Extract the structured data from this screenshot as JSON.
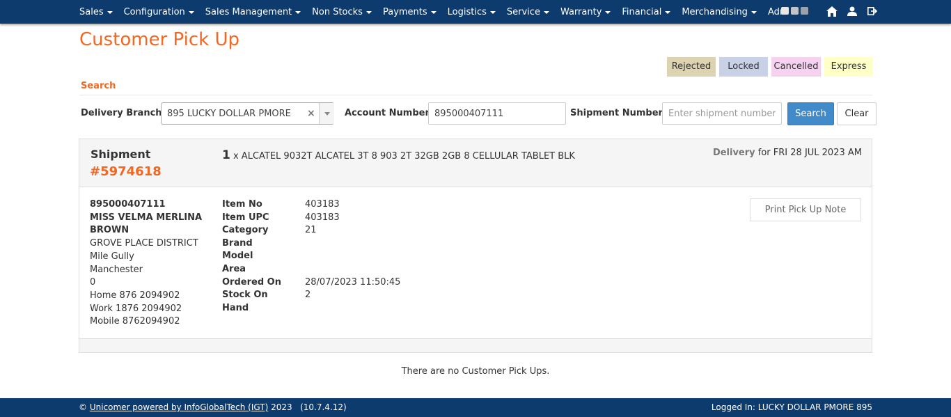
{
  "nav": {
    "items": [
      "Sales",
      "Configuration",
      "Sales Management",
      "Non Stocks",
      "Payments",
      "Logistics",
      "Service",
      "Warranty",
      "Financial",
      "Merchandising",
      "Administration"
    ],
    "icons": [
      "home-icon",
      "user-icon",
      "logout-icon"
    ]
  },
  "page": {
    "title": "Customer Pick Up"
  },
  "legend": [
    {
      "label": "Rejected",
      "color": "#ddd3b0"
    },
    {
      "label": "Locked",
      "color": "#c8d1e6"
    },
    {
      "label": "Cancelled",
      "color": "#f6d2f0"
    },
    {
      "label": "Express",
      "color": "#ffffc8"
    }
  ],
  "search": {
    "section_label": "Search",
    "branch_label": "Delivery Branch:",
    "branch_value": "895 LUCKY DOLLAR PMORE",
    "clear_glyph": "×",
    "account_label": "Account Number:",
    "account_value": "895000407111",
    "shipment_label": "Shipment Number:",
    "shipment_placeholder": "Enter shipment number",
    "search_button": "Search",
    "clear_button": "Clear"
  },
  "shipment": {
    "label": "Shipment",
    "number": "#5974618",
    "qty": "1",
    "item_text": "x ALCATEL 9032T ALCATEL 3T 8 903 2T 32GB 2GB 8 CELLULAR TABLET BLK",
    "delivery_label": "Delivery",
    "delivery_text": "for FRI 28 JUL 2023 AM",
    "customer": {
      "account": "895000407111",
      "name": "MISS VELMA MERLINA BROWN",
      "address": [
        "GROVE PLACE DISTRICT",
        "Mile Gully",
        "Manchester",
        "0"
      ],
      "phones": [
        "Home 876 2094902",
        "Work 1876 2094902",
        "Mobile 8762094902"
      ]
    },
    "details": [
      {
        "label": "Item No",
        "value": "403183"
      },
      {
        "label": "Item UPC",
        "value": "403183"
      },
      {
        "label": "Category",
        "value": "21"
      },
      {
        "label": "Brand",
        "value": ""
      },
      {
        "label": "Model",
        "value": ""
      },
      {
        "label": "Area",
        "value": ""
      },
      {
        "label": "Ordered On",
        "value": "28/07/2023 11:50:45"
      },
      {
        "label": "Stock On Hand",
        "value": "2"
      }
    ],
    "print_button": "Print Pick Up Note"
  },
  "empty_message": "There are no Customer Pick Ups.",
  "footer": {
    "copyright": "©",
    "link_text": "Unicomer powered by InfoGlobalTech (IGT)",
    "year_version": "2023   (10.7.4.12)",
    "logged_in": "Logged In: LUCKY DOLLAR PMORE 895"
  }
}
